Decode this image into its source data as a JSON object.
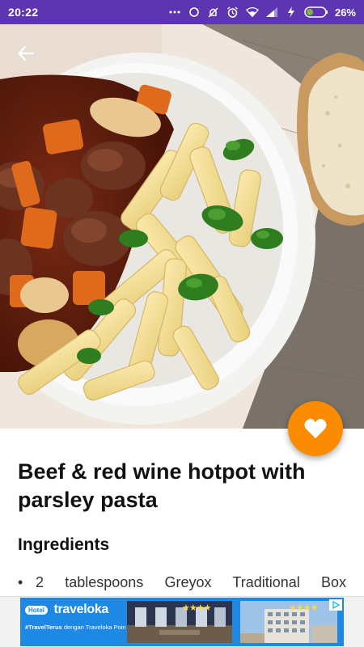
{
  "status_bar": {
    "time": "20:22",
    "battery": "26%",
    "icons": [
      "more-dots-icon",
      "sync-icon",
      "do-not-disturb-icon",
      "alarm-icon",
      "wifi-icon",
      "signal-icon",
      "charging-icon",
      "battery-icon"
    ]
  },
  "hero": {
    "image": "beef-stew-and-penne-pasta-photo",
    "back_icon": "back-arrow-icon"
  },
  "fab": {
    "icon": "heart-icon",
    "color": "#fb8c00"
  },
  "recipe": {
    "title": "Beef & red wine hotpot with parsley pasta",
    "ingredients_heading": "Ingredients",
    "ingredients": [
      "2 tablespoons Greyox Traditional Box"
    ]
  },
  "ad": {
    "hotel_label": "Hotel",
    "brand": "traveloka",
    "hashtag": "#TravelTerus",
    "tagline_rest": "dengan Traveloka Poin",
    "stars_1": "★★★★",
    "stars_2": "★★★★",
    "ad_choices_icon": "ad-choices-icon"
  },
  "colors": {
    "status_bar": "#5e35b1",
    "fab": "#fb8c00",
    "ad_banner": "#1e88e5"
  }
}
